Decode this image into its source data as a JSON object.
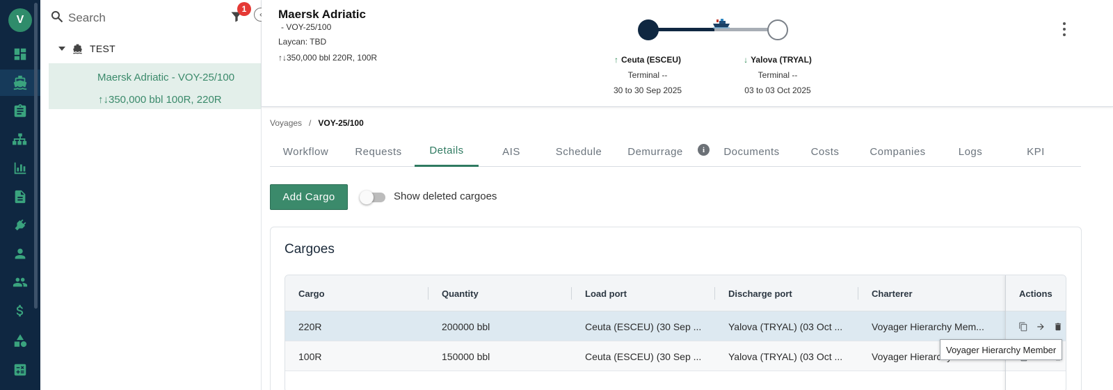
{
  "colors": {
    "rail": "#0f2741",
    "accent": "#3b8a6b",
    "badge": "#e53935"
  },
  "rail": {
    "logo_text": "V",
    "items": [
      "dashboard-icon",
      "ship-icon",
      "clipboard-icon",
      "hierarchy-icon",
      "bar-chart-icon",
      "document-icon",
      "plug-icon",
      "person-icon",
      "people-icon",
      "dollar-icon",
      "shapes-icon",
      "calculator-icon"
    ]
  },
  "tree": {
    "search_placeholder": "Search",
    "filter_count": "1",
    "root_label": "TEST",
    "item_title": "Maersk Adriatic - VOY-25/100",
    "item_qty": "↑↓350,000 bbl 100R, 220R"
  },
  "header": {
    "vessel": "Maersk Adriatic",
    "voyage_code": "- VOY-25/100",
    "laycan": "Laycan: TBD",
    "cargo_summary": "↑↓350,000 bbl 220R, 100R",
    "load_port": {
      "name": "Ceuta (ESCEU)",
      "terminal": "Terminal --",
      "dates": "30 to 30 Sep 2025"
    },
    "discharge_port": {
      "name": "Yalova (TRYAL)",
      "terminal": "Terminal --",
      "dates": "03 to 03 Oct 2025"
    }
  },
  "breadcrumb": {
    "root": "Voyages",
    "separator": "/",
    "current": "VOY-25/100"
  },
  "tabs": [
    "Workflow",
    "Requests",
    "Details",
    "AIS",
    "Schedule",
    "Demurrage",
    "Documents",
    "Costs",
    "Companies",
    "Logs",
    "KPI"
  ],
  "active_tab": "Details",
  "toolbar": {
    "add_cargo": "Add Cargo",
    "show_deleted": "Show deleted cargoes",
    "show_deleted_on": false
  },
  "cargoes": {
    "title": "Cargoes",
    "columns": [
      "Cargo",
      "Quantity",
      "Load port",
      "Discharge port",
      "Charterer",
      "Actions"
    ],
    "rows": [
      {
        "cargo": "220R",
        "quantity": "200000 bbl",
        "load_port": "Ceuta (ESCEU) (30 Sep ...",
        "discharge_port": "Yalova (TRYAL) (03 Oct ...",
        "charterer": "Voyager Hierarchy Mem..."
      },
      {
        "cargo": "100R",
        "quantity": "150000 bbl",
        "load_port": "Ceuta (ESCEU) (30 Sep ...",
        "discharge_port": "Yalova (TRYAL) (03 Oct ...",
        "charterer": "Voyager Hierarchy"
      }
    ],
    "tooltip": "Voyager Hierarchy Member"
  }
}
